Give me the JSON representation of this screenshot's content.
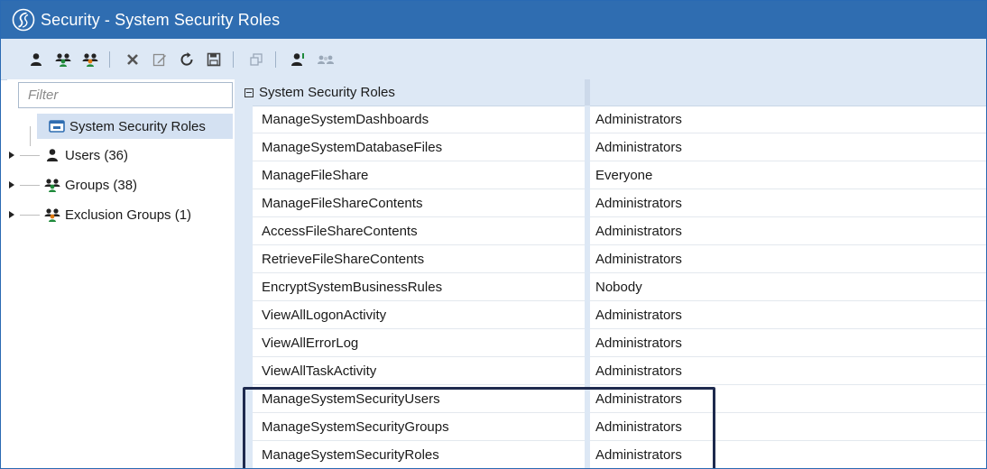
{
  "window": {
    "title": "Security - System Security Roles",
    "logo_icon": "app-logo-icon"
  },
  "toolbar": {
    "buttons": [
      {
        "name": "add-user",
        "icon": "user-icon"
      },
      {
        "name": "add-group",
        "icon": "group-icon"
      },
      {
        "name": "add-exclusion-group",
        "icon": "exclusion-group-icon"
      },
      {
        "name": "delete",
        "icon": "close-icon"
      },
      {
        "name": "edit",
        "icon": "edit-icon"
      },
      {
        "name": "refresh",
        "icon": "refresh-icon"
      },
      {
        "name": "save",
        "icon": "save-icon"
      },
      {
        "name": "copy",
        "icon": "copy-icon"
      },
      {
        "name": "user-properties",
        "icon": "user-properties-icon"
      },
      {
        "name": "group-members",
        "icon": "group-members-icon"
      }
    ]
  },
  "filter": {
    "placeholder": "Filter",
    "value": ""
  },
  "tree": {
    "root": {
      "label": "System Security Roles",
      "icon": "roles-icon"
    },
    "items": [
      {
        "label": "Users (36)",
        "icon": "user-icon"
      },
      {
        "label": "Groups (38)",
        "icon": "group-icon"
      },
      {
        "label": "Exclusion Groups (1)",
        "icon": "exclusion-group-icon"
      }
    ]
  },
  "grid": {
    "group_header": "System Security Roles",
    "rows": [
      {
        "role": "ManageSystemDashboards",
        "value": "Administrators"
      },
      {
        "role": "ManageSystemDatabaseFiles",
        "value": "Administrators"
      },
      {
        "role": "ManageFileShare",
        "value": "Everyone"
      },
      {
        "role": "ManageFileShareContents",
        "value": "Administrators"
      },
      {
        "role": "AccessFileShareContents",
        "value": "Administrators"
      },
      {
        "role": "RetrieveFileShareContents",
        "value": "Administrators"
      },
      {
        "role": "EncryptSystemBusinessRules",
        "value": "Nobody"
      },
      {
        "role": "ViewAllLogonActivity",
        "value": "Administrators"
      },
      {
        "role": "ViewAllErrorLog",
        "value": "Administrators"
      },
      {
        "role": "ViewAllTaskActivity",
        "value": "Administrators"
      },
      {
        "role": "ManageSystemSecurityUsers",
        "value": "Administrators"
      },
      {
        "role": "ManageSystemSecurityGroups",
        "value": "Administrators"
      },
      {
        "role": "ManageSystemSecurityRoles",
        "value": "Administrators"
      }
    ]
  },
  "colors": {
    "titlebar": "#2f6db1",
    "toolbar": "#dde8f5",
    "highlight_border": "#1e2a4e",
    "selection": "#d4e1f2"
  }
}
